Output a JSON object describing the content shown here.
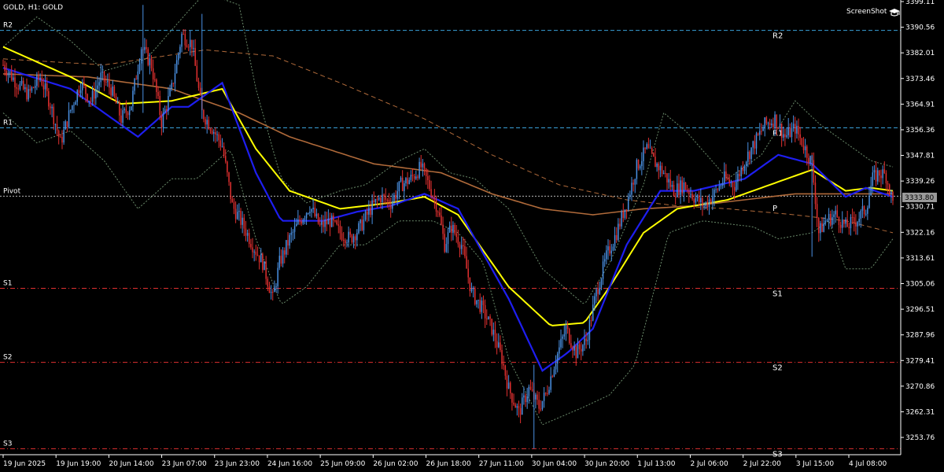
{
  "header": {
    "title": "GOLD, H1:  GOLD",
    "watermark": "ScreenShot"
  },
  "colors": {
    "background": "#000000",
    "bull_candle": "#4a90e2",
    "bear_candle": "#e03030",
    "ma_fast": "#1e1ef0",
    "ma_slow": "#ffff00",
    "ma_long": "#b06a3a",
    "bands": "#6a8a6a",
    "resistance": "#3aa0d8",
    "support": "#e03030",
    "pivot": "#b8b8b8",
    "price_tag": "#9a9a9a"
  },
  "chart_data": {
    "type": "candlestick",
    "symbol": "GOLD",
    "timeframe": "H1",
    "ylim": [
      3248,
      3399.11
    ],
    "y_ticks": [
      "3399.11",
      "3390.56",
      "3382.01",
      "3373.46",
      "3364.91",
      "3356.36",
      "3347.81",
      "3339.26",
      "3330.71",
      "3322.16",
      "3313.61",
      "3305.06",
      "3296.51",
      "3287.96",
      "3279.41",
      "3270.86",
      "3262.31",
      "3253.76"
    ],
    "x_ticks": [
      "19 Jun 2025",
      "19 Jun 19:00",
      "20 Jun 14:00",
      "23 Jun 07:00",
      "23 Jun 23:00",
      "24 Jun 16:00",
      "25 Jun 09:00",
      "26 Jun 02:00",
      "26 Jun 18:00",
      "27 Jun 11:00",
      "30 Jun 04:00",
      "30 Jun 20:00",
      "1 Jul 13:00",
      "2 Jul 06:00",
      "2 Jul 22:00",
      "3 Jul 15:00",
      "4 Jul 08:00"
    ],
    "current_price": "3333.80",
    "levels": [
      {
        "name": "R2",
        "value": 3389.5,
        "kind": "resistance"
      },
      {
        "name": "R1",
        "value": 3357.0,
        "kind": "resistance"
      },
      {
        "name": "Pivot",
        "value": 3334.2,
        "kind": "pivot"
      },
      {
        "name": "S1",
        "value": 3303.5,
        "kind": "support"
      },
      {
        "name": "S2",
        "value": 3278.8,
        "kind": "support"
      },
      {
        "name": "S3",
        "value": 3250.0,
        "kind": "support"
      }
    ],
    "right_level_labels": [
      {
        "name": "R2",
        "value": 3389.5
      },
      {
        "name": "R1",
        "value": 3357.0
      },
      {
        "name": "P",
        "value": 3332.0
      },
      {
        "name": "S1",
        "value": 3303.5
      },
      {
        "name": "S2",
        "value": 3278.8
      },
      {
        "name": "S3",
        "value": 3250.0
      }
    ],
    "close_path": [
      [
        0,
        3378
      ],
      [
        8,
        3372
      ],
      [
        15,
        3368
      ],
      [
        22,
        3374
      ],
      [
        28,
        3365
      ],
      [
        34,
        3352
      ],
      [
        40,
        3363
      ],
      [
        46,
        3372
      ],
      [
        52,
        3366
      ],
      [
        58,
        3374
      ],
      [
        64,
        3370
      ],
      [
        70,
        3360
      ],
      [
        76,
        3365
      ],
      [
        82,
        3384
      ],
      [
        88,
        3378
      ],
      [
        94,
        3359
      ],
      [
        100,
        3370
      ],
      [
        106,
        3388
      ],
      [
        112,
        3385
      ],
      [
        118,
        3362
      ],
      [
        124,
        3357
      ],
      [
        130,
        3351
      ],
      [
        136,
        3331
      ],
      [
        142,
        3325
      ],
      [
        148,
        3318
      ],
      [
        154,
        3312
      ],
      [
        160,
        3300
      ],
      [
        164,
        3312
      ],
      [
        170,
        3320
      ],
      [
        176,
        3326
      ],
      [
        182,
        3331
      ],
      [
        188,
        3324
      ],
      [
        194,
        3326
      ],
      [
        200,
        3322
      ],
      [
        206,
        3320
      ],
      [
        212,
        3324
      ],
      [
        218,
        3330
      ],
      [
        224,
        3334
      ],
      [
        230,
        3332
      ],
      [
        236,
        3338
      ],
      [
        242,
        3340
      ],
      [
        248,
        3344
      ],
      [
        254,
        3336
      ],
      [
        258,
        3330
      ],
      [
        262,
        3318
      ],
      [
        266,
        3324
      ],
      [
        272,
        3318
      ],
      [
        278,
        3302
      ],
      [
        284,
        3297
      ],
      [
        290,
        3290
      ],
      [
        296,
        3280
      ],
      [
        300,
        3270
      ],
      [
        306,
        3262
      ],
      [
        312,
        3270
      ],
      [
        318,
        3264
      ],
      [
        322,
        3268
      ],
      [
        328,
        3280
      ],
      [
        334,
        3290
      ],
      [
        340,
        3282
      ],
      [
        346,
        3286
      ],
      [
        352,
        3302
      ],
      [
        358,
        3314
      ],
      [
        364,
        3322
      ],
      [
        370,
        3332
      ],
      [
        376,
        3344
      ],
      [
        382,
        3350
      ],
      [
        386,
        3346
      ],
      [
        392,
        3342
      ],
      [
        398,
        3336
      ],
      [
        404,
        3338
      ],
      [
        410,
        3334
      ],
      [
        416,
        3331
      ],
      [
        422,
        3335
      ],
      [
        428,
        3340
      ],
      [
        434,
        3338
      ],
      [
        440,
        3346
      ],
      [
        446,
        3352
      ],
      [
        452,
        3358
      ],
      [
        458,
        3360
      ],
      [
        464,
        3354
      ],
      [
        470,
        3357
      ],
      [
        476,
        3350
      ],
      [
        480,
        3345
      ],
      [
        484,
        3322
      ],
      [
        488,
        3326
      ],
      [
        494,
        3328
      ],
      [
        500,
        3324
      ],
      [
        506,
        3326
      ],
      [
        512,
        3330
      ],
      [
        516,
        3340
      ],
      [
        520,
        3342
      ],
      [
        524,
        3341
      ],
      [
        528,
        3332
      ]
    ],
    "series": [
      {
        "name": "",
        "role": "ma_fast",
        "x": [
          0,
          40,
          80,
          100,
          110,
          130,
          150,
          165,
          190,
          210,
          230,
          250,
          270,
          300,
          320,
          335,
          350,
          370,
          390,
          410,
          440,
          460,
          480,
          500,
          512,
          528
        ],
        "values": [
          3377,
          3370,
          3354,
          3364,
          3364,
          3372,
          3342,
          3326,
          3326,
          3329,
          3331,
          3335,
          3330,
          3300,
          3276,
          3282,
          3290,
          3318,
          3336,
          3336,
          3340,
          3348,
          3345,
          3334,
          3337,
          3334
        ]
      },
      {
        "name": "",
        "role": "ma_slow",
        "x": [
          0,
          40,
          70,
          100,
          130,
          150,
          170,
          200,
          230,
          250,
          270,
          300,
          325,
          345,
          360,
          380,
          400,
          430,
          460,
          480,
          500,
          515,
          528
        ],
        "values": [
          3384,
          3374,
          3365,
          3366,
          3370,
          3350,
          3336,
          3330,
          3332,
          3334,
          3328,
          3304,
          3291,
          3292,
          3304,
          3322,
          3330,
          3333,
          3339,
          3343,
          3336,
          3337,
          3336
        ]
      },
      {
        "name": "",
        "role": "ma_long_solid",
        "x": [
          0,
          50,
          100,
          140,
          170,
          220,
          260,
          290,
          320,
          350,
          380,
          410,
          440,
          470,
          500,
          528
        ],
        "values": [
          3375,
          3374,
          3370,
          3362,
          3354,
          3345,
          3342,
          3335,
          3330,
          3328,
          3330,
          3331,
          3333,
          3335,
          3335,
          3335
        ]
      },
      {
        "name": "",
        "role": "ma_long_dashed",
        "x": [
          0,
          60,
          120,
          160,
          200,
          250,
          290,
          330,
          370,
          400,
          430,
          470,
          500,
          528
        ],
        "values": [
          3380,
          3378,
          3383,
          3381,
          3372,
          3360,
          3348,
          3338,
          3333,
          3331,
          3330,
          3328,
          3326,
          3322
        ]
      },
      {
        "name": "",
        "role": "band_upper",
        "x": [
          0,
          20,
          40,
          60,
          85,
          110,
          120,
          140,
          150,
          165,
          180,
          200,
          215,
          235,
          250,
          265,
          280,
          300,
          320,
          345,
          360,
          380,
          392,
          405,
          430,
          450,
          470,
          485,
          500,
          515,
          528
        ],
        "values": [
          3384,
          3394,
          3386,
          3376,
          3380,
          3396,
          3402,
          3398,
          3370,
          3340,
          3332,
          3336,
          3338,
          3346,
          3350,
          3342,
          3340,
          3330,
          3310,
          3298,
          3312,
          3338,
          3362,
          3356,
          3340,
          3348,
          3366,
          3358,
          3352,
          3346,
          3344
        ]
      },
      {
        "name": "",
        "role": "band_lower",
        "x": [
          0,
          20,
          40,
          60,
          80,
          100,
          115,
          135,
          150,
          165,
          180,
          200,
          215,
          235,
          255,
          270,
          285,
          300,
          320,
          345,
          360,
          375,
          385,
          395,
          415,
          430,
          445,
          460,
          480,
          490,
          500,
          515,
          528
        ],
        "values": [
          3362,
          3352,
          3356,
          3346,
          3330,
          3340,
          3340,
          3350,
          3320,
          3298,
          3304,
          3318,
          3318,
          3326,
          3326,
          3322,
          3312,
          3280,
          3258,
          3264,
          3268,
          3278,
          3300,
          3322,
          3326,
          3325,
          3324,
          3320,
          3322,
          3326,
          3310,
          3310,
          3320
        ]
      }
    ]
  }
}
